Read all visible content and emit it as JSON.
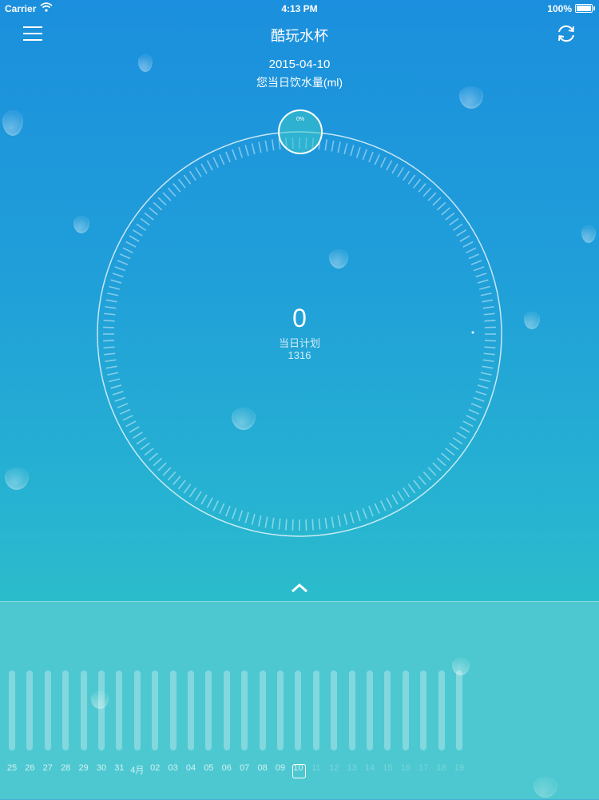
{
  "status_bar": {
    "carrier": "Carrier",
    "time": "4:13 PM",
    "battery": "100%"
  },
  "nav": {
    "title": "酷玩水杯",
    "menu_icon": "hamburger-menu-icon",
    "refresh_icon": "refresh-icon"
  },
  "header": {
    "date": "2015-04-10",
    "subtitle": "您当日饮水量(ml)"
  },
  "dial": {
    "value": "0",
    "plan_label": "当日计划",
    "plan_value": "1316",
    "handle_percent": "0%",
    "progress": 0
  },
  "timeline": {
    "days": [
      "25",
      "26",
      "27",
      "28",
      "29",
      "30",
      "31",
      "4月",
      "02",
      "03",
      "04",
      "05",
      "06",
      "07",
      "08",
      "09",
      "10",
      "11",
      "12",
      "13",
      "14",
      "15",
      "16",
      "17",
      "18",
      "19"
    ],
    "selected_index": 16,
    "future_from_index": 17
  },
  "colors": {
    "bg_top": "#1b8fdd",
    "bg_bottom": "#2bbccb",
    "panel": "#78d7d7"
  }
}
